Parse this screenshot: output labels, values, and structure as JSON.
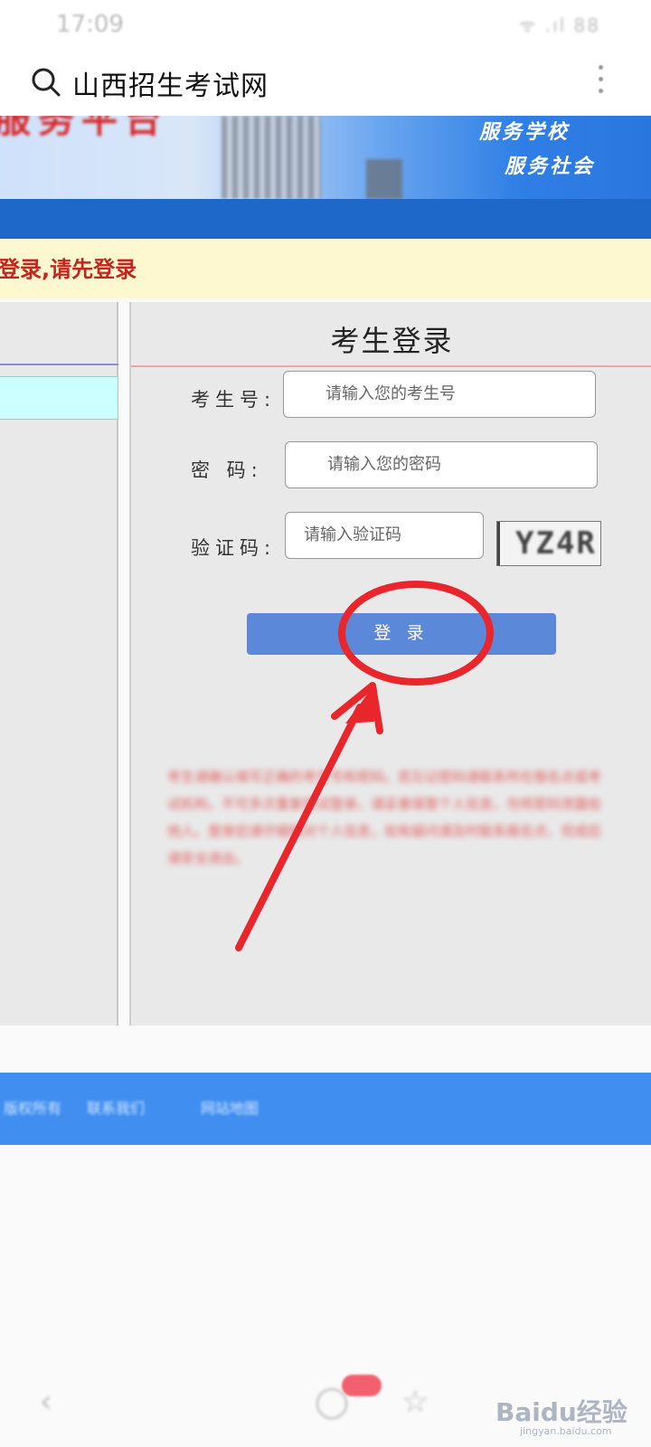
{
  "status_bar": {
    "time": "17:09",
    "icons": "ᯤ .ıl 88"
  },
  "title_bar": {
    "title": "山西招生考试网"
  },
  "banner": {
    "slogan_line1": "服务学校",
    "slogan_line2": "服务社会",
    "red_text": "服务平台"
  },
  "notice": {
    "text": "登录,请先登录"
  },
  "login": {
    "title": "考生登录",
    "exam_no_label": "考生号:",
    "exam_no_placeholder": "请输入您的考生号",
    "password_label": "密 码:",
    "password_placeholder": "请输入您的密码",
    "captcha_label": "验证码:",
    "captcha_placeholder": "请输入验证码",
    "captcha_image_text": "YZ4R",
    "submit_label": "登 录",
    "notes_text": "考生请确认填写正确的考生号和密码。若忘记密码请联系所在报名点或考试机构，不可多次重复尝试登录。请妥善保管个人信息，勿将密码泄露给他人。登录后请仔细核对个人信息，如有疑问请及时联系报名点，完成后请安全退出。"
  },
  "footer": {
    "item1": "版权所有",
    "item2": "联系我们",
    "item3": "网站地图"
  },
  "bottom_nav": {
    "back_icon": "‹",
    "tabs_icon": "◯",
    "star_icon": "☆",
    "watermark": "Baidu经验",
    "watermark_url": "jingyan.baidu.com"
  },
  "colors": {
    "accent_blue": "#2f7fe6",
    "button_blue": "#5b88d8",
    "notice_red": "#c2271f",
    "annotation_red": "#e8262b"
  }
}
